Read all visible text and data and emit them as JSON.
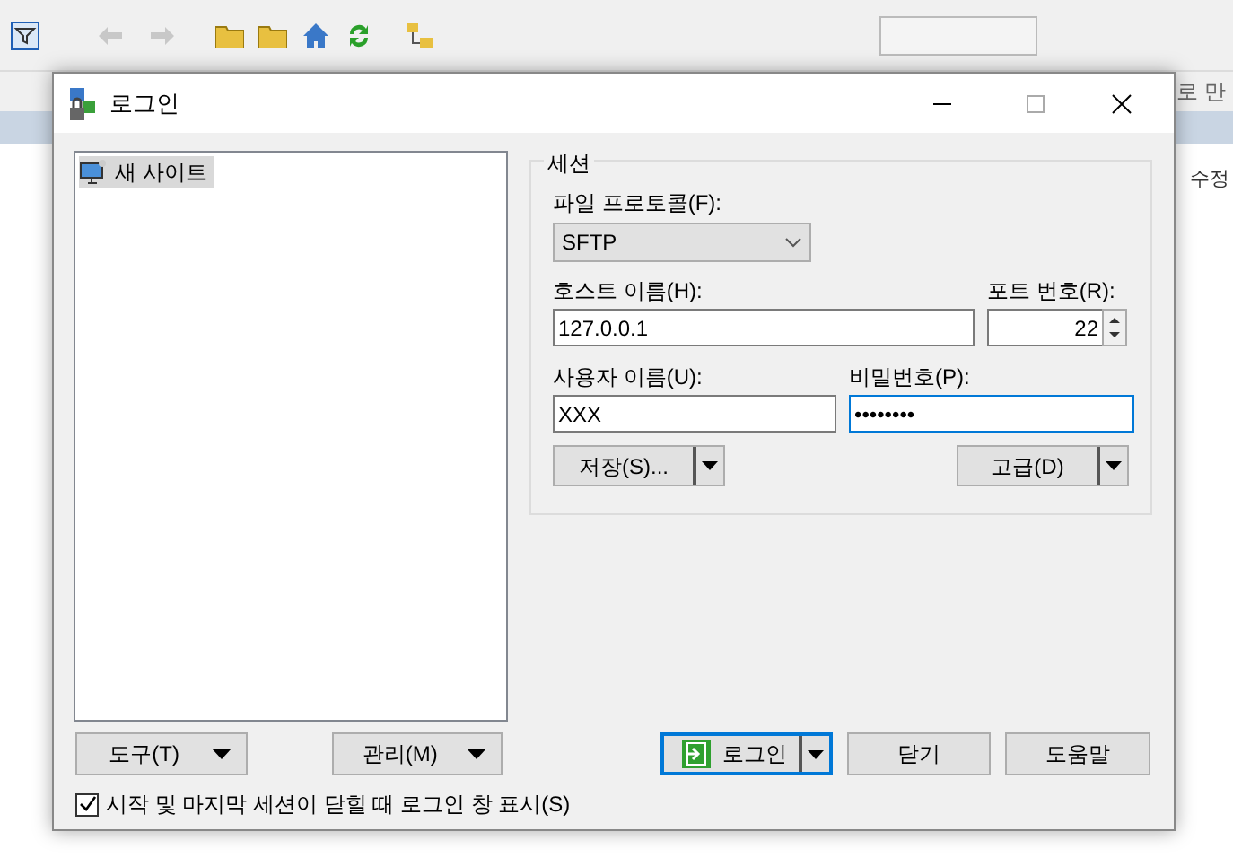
{
  "background": {
    "header_texts": [
      "로 만",
      "수정"
    ]
  },
  "dialog": {
    "title": "로그인",
    "site_tree": [
      {
        "label": "새 사이트",
        "selected": true
      }
    ],
    "session": {
      "group_title": "세션",
      "protocol": {
        "label": "파일 프로토콜(F):",
        "value": "SFTP"
      },
      "host": {
        "label": "호스트 이름(H):",
        "value": "127.0.0.1"
      },
      "port": {
        "label": "포트 번호(R):",
        "value": "22"
      },
      "user": {
        "label": "사용자 이름(U):",
        "value": "XXX"
      },
      "password": {
        "label": "비밀번호(P):",
        "value": "••••••••",
        "focused": true
      },
      "save_button": "저장(S)...",
      "advanced_button": "고급(D)"
    },
    "tools_button": "도구(T)",
    "manage_button": "관리(M)",
    "login_button": "로그인",
    "close_button": "닫기",
    "help_button": "도움말",
    "show_on_startup": {
      "label": "시작 및 마지막 세션이 닫힐 때 로그인 창 표시(S)",
      "checked": true
    }
  }
}
